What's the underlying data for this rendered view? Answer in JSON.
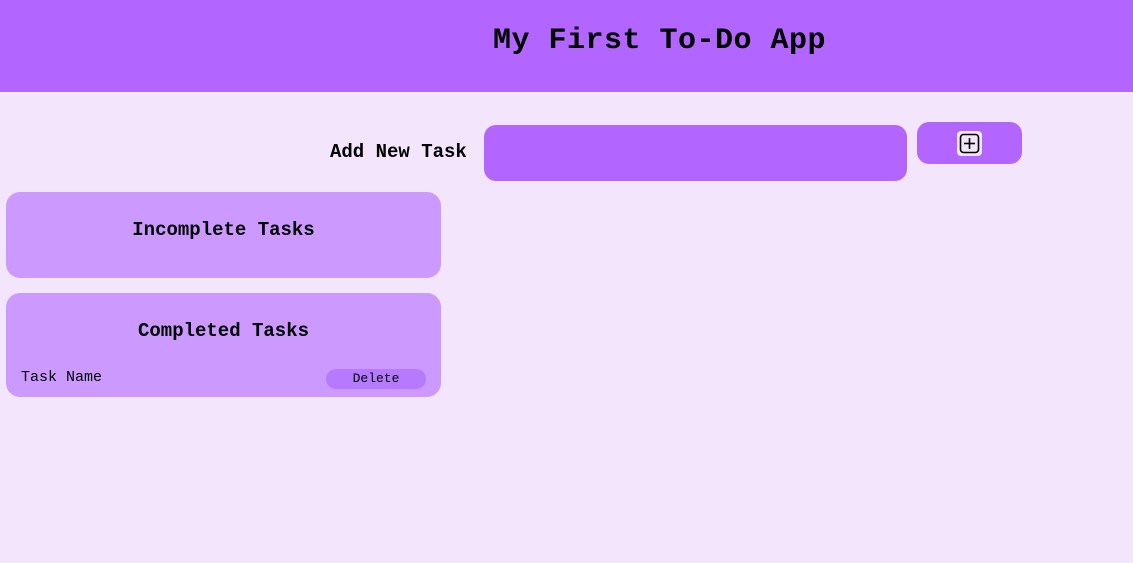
{
  "header": {
    "title": "My First To-Do App"
  },
  "add_task": {
    "label": "Add New Task",
    "input_value": "",
    "button_icon": "plus-square-icon"
  },
  "incomplete": {
    "title": "Incomplete Tasks",
    "tasks": []
  },
  "completed": {
    "title": "Completed Tasks",
    "tasks": [
      {
        "name": "Task Name",
        "delete_label": "Delete"
      }
    ]
  },
  "colors": {
    "header_bg": "#b266ff",
    "page_bg": "#f3e5fc",
    "panel_bg": "#cb99ff",
    "input_bg": "#b266ff",
    "delete_bg": "#b57aff"
  }
}
